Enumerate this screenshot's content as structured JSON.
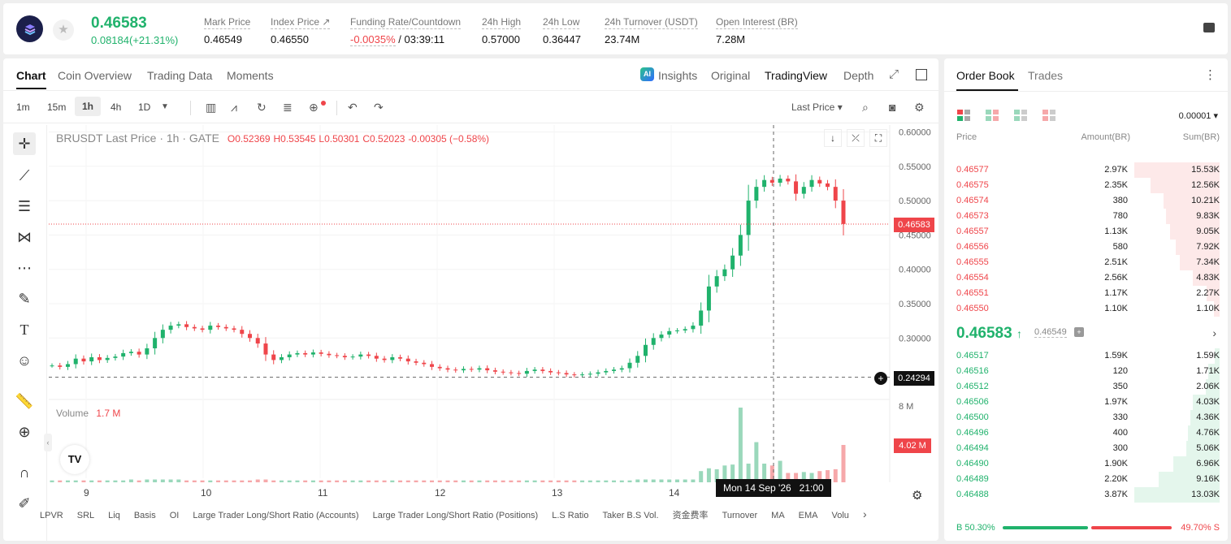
{
  "header": {
    "last_price": "0.46583",
    "change": "0.08184(+21.31%)",
    "stats": [
      {
        "label": "Mark Price",
        "value": "0.46549"
      },
      {
        "label": "Index Price ↗",
        "value": "0.46550"
      },
      {
        "label": "Funding Rate/Countdown",
        "value": "-0.0035%",
        "value2": "/ 03:39:11"
      },
      {
        "label": "24h High",
        "value": "0.57000"
      },
      {
        "label": "24h Low",
        "value": "0.36447"
      },
      {
        "label": "24h Turnover (USDT)",
        "value": "23.74M"
      },
      {
        "label": "Open Interest (BR)",
        "value": "7.28M"
      }
    ]
  },
  "chart_tabs": [
    "Chart",
    "Coin Overview",
    "Trading Data",
    "Moments"
  ],
  "view_tabs": {
    "insights": "Insights",
    "original": "Original",
    "tradingview": "TradingView",
    "depth": "Depth",
    "ai_badge": "AI"
  },
  "timeframes": [
    "1m",
    "15m",
    "1h",
    "4h",
    "1D"
  ],
  "price_mode": "Last Price ▾",
  "chart": {
    "legend_symbol": "BRUSDT Last Price · 1h · GATE",
    "ohlc": {
      "o": "O0.52369",
      "h": "H0.53545",
      "l": "L0.50301",
      "c": "C0.52023",
      "chg": "-0.00305 (−0.58%)"
    },
    "volume_label": "Volume",
    "volume_value": "1.7 M",
    "last_price_tag": "0.46583",
    "cursor_price_tag": "0.24294",
    "volume_tag": "4.02 M",
    "volume_axis": "8 M",
    "cursor_time": "Mon 14 Sep '26   21:00",
    "tv_logo": "TV"
  },
  "chart_data": {
    "type": "candlestick",
    "title": "BRUSDT Last Price · 1h · GATE",
    "y_ticks": [
      "0.60000",
      "0.55000",
      "0.50000",
      "0.45000",
      "0.40000",
      "0.35000",
      "0.30000"
    ],
    "x_ticks": [
      "9",
      "10",
      "11",
      "12",
      "13",
      "14"
    ],
    "ylim": [
      0.22,
      0.61
    ],
    "series": [
      {
        "name": "Price",
        "values": [
          0.26,
          0.258,
          0.262,
          0.27,
          0.266,
          0.272,
          0.268,
          0.271,
          0.273,
          0.278,
          0.28,
          0.276,
          0.285,
          0.3,
          0.312,
          0.318,
          0.32,
          0.316,
          0.314,
          0.312,
          0.318,
          0.316,
          0.314,
          0.312,
          0.306,
          0.3,
          0.292,
          0.276,
          0.268,
          0.272,
          0.276,
          0.278,
          0.276,
          0.279,
          0.277,
          0.275,
          0.274,
          0.272,
          0.273,
          0.276,
          0.274,
          0.27,
          0.268,
          0.272,
          0.27,
          0.266,
          0.264,
          0.262,
          0.258,
          0.256,
          0.254,
          0.253,
          0.255,
          0.254,
          0.256,
          0.253,
          0.251,
          0.25,
          0.249,
          0.248,
          0.252,
          0.254,
          0.252,
          0.25,
          0.249,
          0.247,
          0.246,
          0.247,
          0.248,
          0.25,
          0.252,
          0.254,
          0.256,
          0.264,
          0.274,
          0.29,
          0.3,
          0.305,
          0.31,
          0.311,
          0.313,
          0.318,
          0.34,
          0.375,
          0.39,
          0.4,
          0.42,
          0.45,
          0.5,
          0.52,
          0.53,
          0.526,
          0.532,
          0.528,
          0.51,
          0.52,
          0.53,
          0.525,
          0.52,
          0.5,
          0.466
        ]
      }
    ],
    "volume_values": [
      0.2,
      0.2,
      0.2,
      0.2,
      0.2,
      0.2,
      0.2,
      0.2,
      0.2,
      0.2,
      0.3,
      0.2,
      0.3,
      0.3,
      0.3,
      0.3,
      0.3,
      0.2,
      0.2,
      0.2,
      0.2,
      0.2,
      0.2,
      0.2,
      0.2,
      0.2,
      0.3,
      0.3,
      0.2,
      0.2,
      0.2,
      0.2,
      0.2,
      0.2,
      0.2,
      0.2,
      0.2,
      0.2,
      0.2,
      0.2,
      0.2,
      0.2,
      0.2,
      0.2,
      0.2,
      0.2,
      0.2,
      0.2,
      0.2,
      0.2,
      0.2,
      0.2,
      0.2,
      0.2,
      0.2,
      0.2,
      0.2,
      0.2,
      0.2,
      0.2,
      0.2,
      0.2,
      0.2,
      0.2,
      0.2,
      0.2,
      0.2,
      0.2,
      0.2,
      0.2,
      0.2,
      0.2,
      0.2,
      0.2,
      0.3,
      0.3,
      0.3,
      0.3,
      0.3,
      0.3,
      0.3,
      0.3,
      1.2,
      1.5,
      1.4,
      1.8,
      1.9,
      8.0,
      2.0,
      4.3,
      2.0,
      1.8,
      2.3,
      1.0,
      1.0,
      1.1,
      1.0,
      1.2,
      1.3,
      1.4,
      4.0
    ]
  },
  "bottom_indicators": [
    "LPVR",
    "SRL",
    "Liq",
    "Basis",
    "OI",
    "Large Trader Long/Short Ratio (Accounts)",
    "Large Trader Long/Short Ratio (Positions)",
    "L.S Ratio",
    "Taker B.S Vol.",
    "资金费率",
    "Turnover",
    "MA",
    "EMA",
    "Volu"
  ],
  "orderbook": {
    "tabs": [
      "Order Book",
      "Trades"
    ],
    "precision": "0.00001",
    "headers": [
      "Price",
      "Amount(BR)",
      "Sum(BR)"
    ],
    "asks": [
      {
        "price": "0.46577",
        "amount": "2.97K",
        "sum": "15.53K",
        "depth": 1.0
      },
      {
        "price": "0.46575",
        "amount": "2.35K",
        "sum": "12.56K",
        "depth": 0.81
      },
      {
        "price": "0.46574",
        "amount": "380",
        "sum": "10.21K",
        "depth": 0.66
      },
      {
        "price": "0.46573",
        "amount": "780",
        "sum": "9.83K",
        "depth": 0.63
      },
      {
        "price": "0.46557",
        "amount": "1.13K",
        "sum": "9.05K",
        "depth": 0.58
      },
      {
        "price": "0.46556",
        "amount": "580",
        "sum": "7.92K",
        "depth": 0.51
      },
      {
        "price": "0.46555",
        "amount": "2.51K",
        "sum": "7.34K",
        "depth": 0.47
      },
      {
        "price": "0.46554",
        "amount": "2.56K",
        "sum": "4.83K",
        "depth": 0.31
      },
      {
        "price": "0.46551",
        "amount": "1.17K",
        "sum": "2.27K",
        "depth": 0.15
      },
      {
        "price": "0.46550",
        "amount": "1.10K",
        "sum": "1.10K",
        "depth": 0.07
      }
    ],
    "mid_price": "0.46583",
    "mid_arrow": "↑",
    "mid_mark": "0.46549",
    "bids": [
      {
        "price": "0.46517",
        "amount": "1.59K",
        "sum": "1.59K",
        "depth": 0.06
      },
      {
        "price": "0.46516",
        "amount": "120",
        "sum": "1.71K",
        "depth": 0.13
      },
      {
        "price": "0.46512",
        "amount": "350",
        "sum": "2.06K",
        "depth": 0.16
      },
      {
        "price": "0.46506",
        "amount": "1.97K",
        "sum": "4.03K",
        "depth": 0.31
      },
      {
        "price": "0.46500",
        "amount": "330",
        "sum": "4.36K",
        "depth": 0.34
      },
      {
        "price": "0.46496",
        "amount": "400",
        "sum": "4.76K",
        "depth": 0.37
      },
      {
        "price": "0.46494",
        "amount": "300",
        "sum": "5.06K",
        "depth": 0.39
      },
      {
        "price": "0.46490",
        "amount": "1.90K",
        "sum": "6.96K",
        "depth": 0.54
      },
      {
        "price": "0.46489",
        "amount": "2.20K",
        "sum": "9.16K",
        "depth": 0.71
      },
      {
        "price": "0.46488",
        "amount": "3.87K",
        "sum": "13.03K",
        "depth": 1.0
      }
    ],
    "buy_ratio": "B 50.30%",
    "sell_ratio": "49.70% S",
    "buy_fraction": 0.503
  },
  "colors": {
    "up": "#20b26c",
    "down": "#ef454a"
  }
}
